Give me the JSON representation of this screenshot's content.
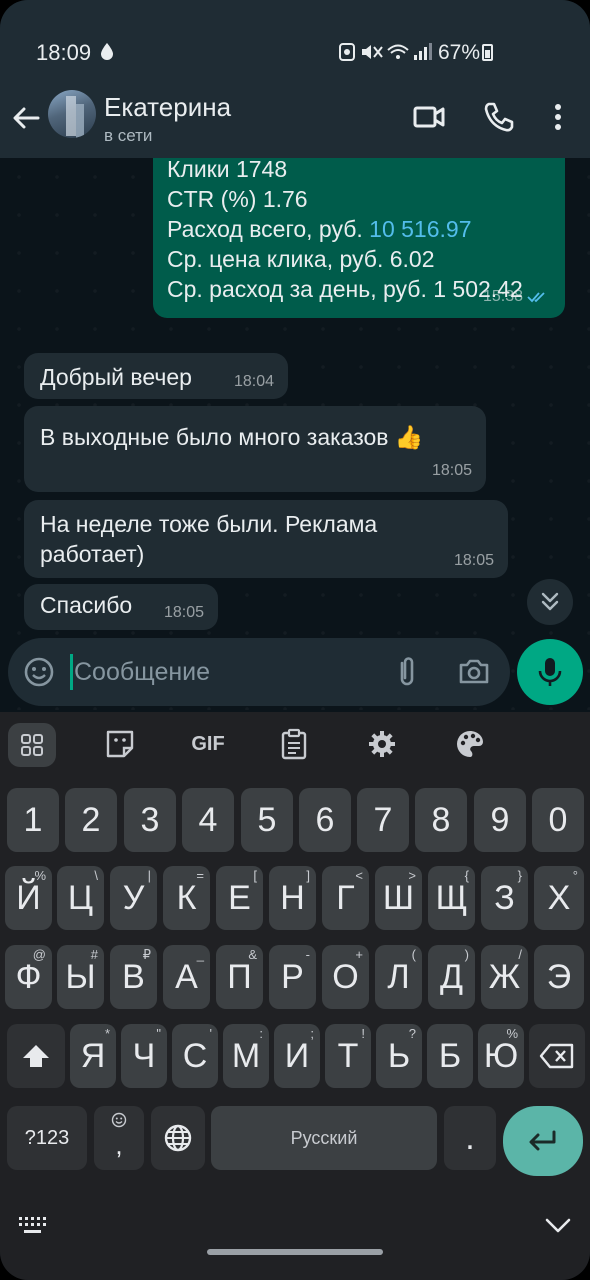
{
  "status_bar": {
    "time": "18:09",
    "battery": "67%"
  },
  "header": {
    "contact_name": "Екатерина",
    "contact_status": "в сети"
  },
  "messages": {
    "outgoing": {
      "lines": [
        "Клики 1748",
        "CTR (%) 1.76",
        "Расход всего, руб.",
        "Ср. цена клика, руб. 6.02",
        "Ср. расход за день, руб. 1 502.42"
      ],
      "spend_link": "10 516.97",
      "time": "15:38"
    },
    "incoming": [
      {
        "text": "Добрый вечер",
        "time": "18:04"
      },
      {
        "text": "В выходные было много заказов 👍",
        "time": "18:05"
      },
      {
        "text": "На неделе тоже были. Реклама работает)",
        "time": "18:05"
      },
      {
        "text": "Спасибо",
        "time": "18:05"
      }
    ]
  },
  "composer": {
    "placeholder": "Сообщение"
  },
  "keyboard": {
    "toolbar": {
      "gif": "GIF"
    },
    "numbers": [
      "1",
      "2",
      "3",
      "4",
      "5",
      "6",
      "7",
      "8",
      "9",
      "0"
    ],
    "row1": [
      {
        "k": "Й",
        "s": "%"
      },
      {
        "k": "Ц",
        "s": "\\"
      },
      {
        "k": "У",
        "s": "|"
      },
      {
        "k": "К",
        "s": "="
      },
      {
        "k": "Е",
        "s": "["
      },
      {
        "k": "Н",
        "s": "]"
      },
      {
        "k": "Г",
        "s": "<"
      },
      {
        "k": "Ш",
        "s": ">"
      },
      {
        "k": "Щ",
        "s": "{"
      },
      {
        "k": "З",
        "s": "}"
      },
      {
        "k": "Х",
        "s": "°"
      }
    ],
    "row2": [
      {
        "k": "Ф",
        "s": "@"
      },
      {
        "k": "Ы",
        "s": "#"
      },
      {
        "k": "В",
        "s": "₽"
      },
      {
        "k": "А",
        "s": "_"
      },
      {
        "k": "П",
        "s": "&"
      },
      {
        "k": "Р",
        "s": "-"
      },
      {
        "k": "О",
        "s": "+"
      },
      {
        "k": "Л",
        "s": "("
      },
      {
        "k": "Д",
        "s": ")"
      },
      {
        "k": "Ж",
        "s": "/"
      },
      {
        "k": "Э",
        "s": ""
      }
    ],
    "row3": [
      {
        "k": "Я",
        "s": "*"
      },
      {
        "k": "Ч",
        "s": "\""
      },
      {
        "k": "С",
        "s": "'"
      },
      {
        "k": "М",
        "s": ":"
      },
      {
        "k": "И",
        "s": ";"
      },
      {
        "k": "Т",
        "s": "!"
      },
      {
        "k": "Ь",
        "s": "?"
      },
      {
        "k": "Б",
        "s": ""
      },
      {
        "k": "Ю",
        "s": "%"
      }
    ],
    "symbols_label": "?123",
    "comma": ",",
    "space_label": "Русский",
    "period": "."
  }
}
